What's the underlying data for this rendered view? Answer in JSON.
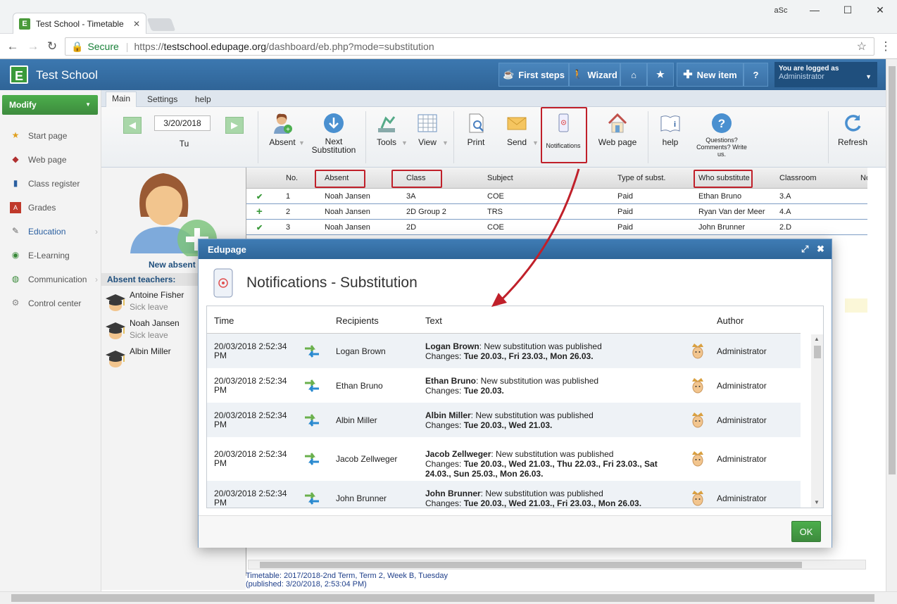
{
  "browser": {
    "tab_title": "Test School - Timetable",
    "tab_close": "✕",
    "secure_label": "Secure",
    "url_scheme": "https://",
    "url_host": "testschool.edupage.org",
    "url_path": "/dashboard/eb.php?mode=substitution",
    "ext_label": "aSc"
  },
  "app": {
    "school_name": "Test School",
    "logo_letter": "E",
    "top_buttons": {
      "first_steps": "First steps",
      "wizard": "Wizard",
      "new_item": "New item",
      "help": "?"
    },
    "user": {
      "logged_as": "You are logged as",
      "role": "Administrator"
    }
  },
  "sidebar": {
    "modify_label": "Modify",
    "items": [
      {
        "label": "Start page",
        "icon": "star-icon"
      },
      {
        "label": "Web page",
        "icon": "web-icon"
      },
      {
        "label": "Class register",
        "icon": "book-icon"
      },
      {
        "label": "Grades",
        "icon": "grades-icon"
      },
      {
        "label": "Education",
        "icon": "education-icon"
      },
      {
        "label": "E-Learning",
        "icon": "globe-icon"
      },
      {
        "label": "Communication",
        "icon": "communication-icon"
      },
      {
        "label": "Control center",
        "icon": "gear-icon"
      }
    ]
  },
  "ribbon": {
    "tabs": [
      "Main",
      "Settings",
      "help"
    ],
    "date": "3/20/2018",
    "day": "Tu",
    "absent": "Absent",
    "next_substitution": "Next Substitution",
    "tools": "Tools",
    "view": "View",
    "print": "Print",
    "send": "Send",
    "notifications": "Notifications",
    "web_page": "Web page",
    "help": "help",
    "questions": "Questions? Comments? Write us.",
    "refresh": "Refresh"
  },
  "absent_panel": {
    "new_absent": "New absent",
    "header": "Absent teachers:",
    "teachers": [
      {
        "name": "Antoine Fisher",
        "status": "Sick leave"
      },
      {
        "name": "Noah Jansen",
        "status": "Sick leave"
      },
      {
        "name": "Albin Miller",
        "status": ""
      }
    ]
  },
  "grid": {
    "columns": [
      "No.",
      "Absent",
      "Class",
      "Subject",
      "Type of subst.",
      "Who substitute",
      "Classroom",
      "No"
    ],
    "rows": [
      {
        "mark": "✔",
        "no": "1",
        "absent": "Noah Jansen",
        "class": "3A",
        "subject": "COE",
        "type": "Paid",
        "who": "Ethan Bruno",
        "room": "3.A"
      },
      {
        "mark": "+",
        "no": "2",
        "absent": "Noah Jansen",
        "class": "2D Group 2",
        "subject": "TRS",
        "type": "Paid",
        "who": "Ryan Van der Meer",
        "room": "4.A"
      },
      {
        "mark": "✔",
        "no": "3",
        "absent": "Noah Jansen",
        "class": "2D",
        "subject": "COE",
        "type": "Paid",
        "who": "John Brunner",
        "room": "2.D"
      }
    ]
  },
  "footer": {
    "line1": "Timetable: 2017/2018-2nd Term, Term 2, Week B, Tuesday",
    "line2": "(published: 3/20/2018, 2:53:04 PM)"
  },
  "modal": {
    "title": "Edupage",
    "heading": "Notifications - Substitution",
    "columns": {
      "time": "Time",
      "recipients": "Recipients",
      "text": "Text",
      "author": "Author"
    },
    "rows": [
      {
        "time": "20/03/2018 2:52:34 PM",
        "recipient": "Logan Brown",
        "name": "Logan Brown",
        "msg": ": New substitution was published",
        "changes_label": "Changes: ",
        "changes": "Tue 20.03., Fri 23.03., Mon 26.03.",
        "author": "Administrator"
      },
      {
        "time": "20/03/2018 2:52:34 PM",
        "recipient": "Ethan Bruno",
        "name": "Ethan Bruno",
        "msg": ": New substitution was published",
        "changes_label": "Changes: ",
        "changes": "Tue 20.03.",
        "author": "Administrator"
      },
      {
        "time": "20/03/2018 2:52:34 PM",
        "recipient": "Albin Miller",
        "name": "Albin Miller",
        "msg": ": New substitution was published",
        "changes_label": "Changes: ",
        "changes": "Tue 20.03., Wed 21.03.",
        "author": "Administrator"
      },
      {
        "time": "20/03/2018 2:52:34 PM",
        "recipient": "Jacob Zellweger",
        "name": "Jacob Zellweger",
        "msg": ": New substitution was published",
        "changes_label": "Changes: ",
        "changes": "Tue 20.03., Wed 21.03., Thu 22.03., Fri 23.03., Sat 24.03., Sun 25.03., Mon 26.03.",
        "author": "Administrator"
      },
      {
        "time": "20/03/2018 2:52:34 PM",
        "recipient": "John Brunner",
        "name": "John Brunner",
        "msg": ": New substitution was published",
        "changes_label": "Changes: ",
        "changes": "Tue 20.03., Wed 21.03., Fri 23.03., Mon 26.03.",
        "author": "Administrator"
      }
    ],
    "ok": "OK"
  },
  "colors": {
    "accent": "#2f6699",
    "green": "#3d8b3d",
    "annotation_red": "#c0202a"
  }
}
